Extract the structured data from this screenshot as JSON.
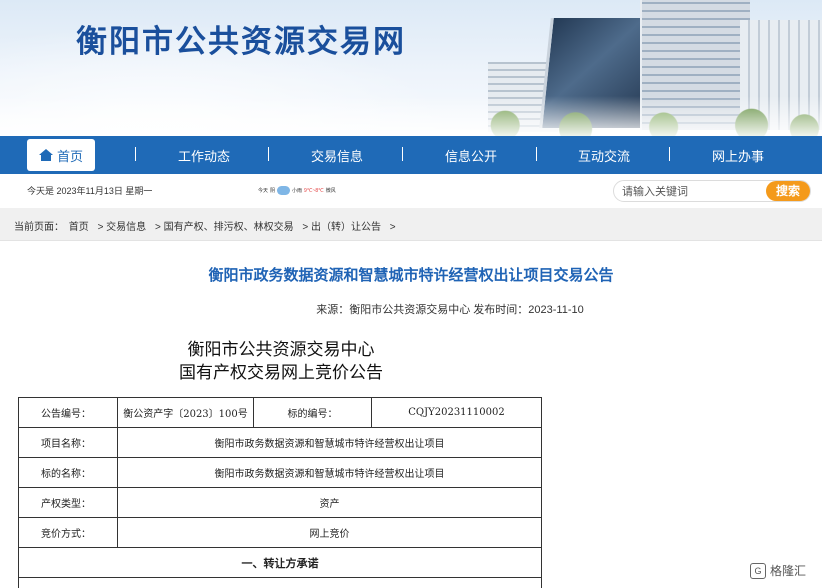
{
  "banner": {
    "site_title": "衡阳市公共资源交易网"
  },
  "nav": {
    "home": "首页",
    "items": [
      "工作动态",
      "交易信息",
      "信息公开",
      "互动交流",
      "网上办事"
    ]
  },
  "infobar": {
    "date": "今天是 2023年11月13日  星期一",
    "weather_day": "今天",
    "weather_cond": "阴",
    "weather_temp": "9℃~8℃",
    "weather_extra": "小雨",
    "weather_wind": "微风"
  },
  "search": {
    "placeholder": "请输入关键词",
    "button": "搜索"
  },
  "breadcrumb": {
    "prefix": "当前页面：",
    "items": [
      "首页",
      ">  交易信息",
      ">  国有产权、排污权、林权交易",
      ">  出（转）让公告",
      ">"
    ]
  },
  "article": {
    "title": "衡阳市政务数据资源和智慧城市特许经营权出让项目交易公告",
    "source": "来源：衡阳市公共资源交易中心",
    "published": "发布时间：2023-11-10",
    "head_line1": "衡阳市公共资源交易中心",
    "head_line2": "国有产权交易网上竞价公告"
  },
  "table": {
    "r1": {
      "l1": "公告编号：",
      "v1": "衡公资产字〔2023〕100号",
      "l2": "标的编号：",
      "v2": "CQJY20231110002"
    },
    "r2": {
      "l": "项目名称：",
      "v": "衡阳市政务数据资源和智慧城市特许经营权出让项目"
    },
    "r3": {
      "l": "标的名称：",
      "v": "衡阳市政务数据资源和智慧城市特许经营权出让项目"
    },
    "r4": {
      "l": "产权类型：",
      "v": "资产"
    },
    "r5": {
      "l": "竞价方式：",
      "v": "网上竞价"
    },
    "section1": "一、转让方承诺"
  },
  "watermark": {
    "text": "格隆汇",
    "logo": "G"
  }
}
